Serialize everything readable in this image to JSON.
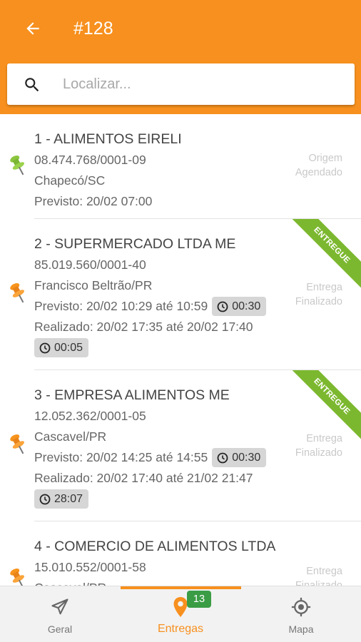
{
  "header": {
    "title": "#128",
    "bg_color": "#f7901e"
  },
  "search": {
    "placeholder": "Localizar...",
    "value": ""
  },
  "stops": [
    {
      "name": "1 - ALIMENTOS EIRELI",
      "cnpj": "08.474.768/0001-09",
      "city": "Chapecó/SC",
      "previsto": "Previsto: 20/02 07:00",
      "status_type": "Origem",
      "status_state": "Agendado",
      "pin_color": "green"
    },
    {
      "name": "2 - SUPERMERCADO LTDA ME",
      "cnpj": "85.019.560/0001-40",
      "city": "Francisco Beltrão/PR",
      "previsto": "Previsto: 20/02 10:29 até 10:59",
      "previsto_duration": "00:30",
      "realizado": "Realizado: 20/02 17:35 até 20/02 17:40",
      "realizado_duration": "00:05",
      "status_type": "Entrega",
      "status_state": "Finalizado",
      "ribbon": "ENTREGUE",
      "pin_color": "orange"
    },
    {
      "name": "3 - EMPRESA ALIMENTOS ME",
      "cnpj": "12.052.362/0001-05",
      "city": "Cascavel/PR",
      "previsto": "Previsto: 20/02 14:25 até 14:55",
      "previsto_duration": "00:30",
      "realizado": "Realizado: 20/02 17:40 até 21/02 21:47",
      "realizado_duration": "28:07",
      "status_type": "Entrega",
      "status_state": "Finalizado",
      "ribbon": "ENTREGUE",
      "pin_color": "orange"
    },
    {
      "name": "4 - COMERCIO DE ALIMENTOS LTDA",
      "cnpj": "15.010.552/0001-58",
      "city": "Cascavel/PR",
      "status_type": "Entrega",
      "status_state": "Finalizado",
      "pin_color": "orange"
    }
  ],
  "nav": {
    "geral": "Geral",
    "entregas": "Entregas",
    "mapa": "Mapa",
    "entregas_badge": "13",
    "active": "entregas"
  },
  "colors": {
    "accent": "#f7901e",
    "ribbon": "#7cb82f",
    "badge": "#3a9c45",
    "pin_green": "#8cc63f",
    "pin_orange": "#f7941d"
  }
}
